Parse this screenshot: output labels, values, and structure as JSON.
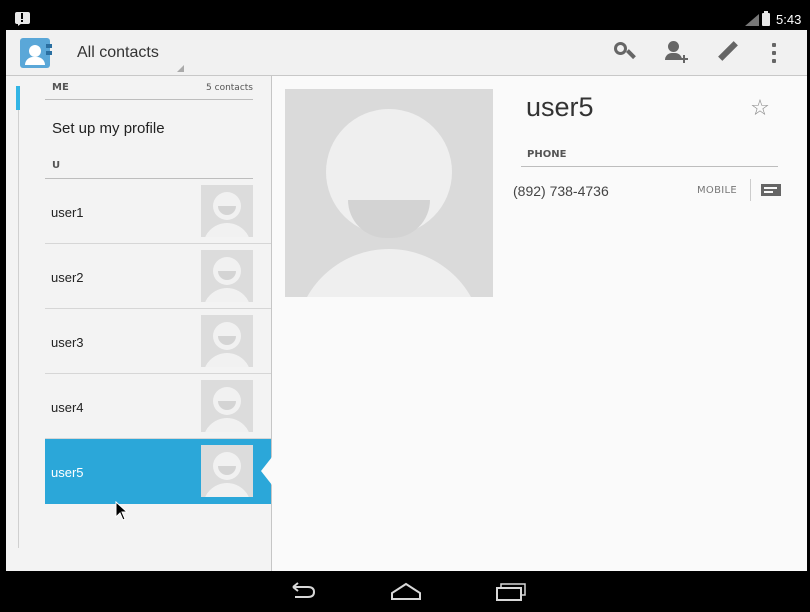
{
  "status_bar": {
    "time": "5:43",
    "notification_icon": "notification-alert-icon",
    "signal_icon": "signal-icon",
    "battery_icon": "battery-icon"
  },
  "action_bar": {
    "app_icon": "contacts-app-icon",
    "filter_label": "All contacts",
    "actions": [
      "search-icon",
      "add-contact-icon",
      "edit-icon",
      "overflow-menu-icon"
    ]
  },
  "list": {
    "me_section": {
      "title": "ME",
      "count_label": "5 contacts"
    },
    "setup_profile_label": "Set up my profile",
    "group_header": "U",
    "contacts": [
      {
        "name": "user1",
        "selected": false
      },
      {
        "name": "user2",
        "selected": false
      },
      {
        "name": "user3",
        "selected": false
      },
      {
        "name": "user4",
        "selected": false
      },
      {
        "name": "user5",
        "selected": true
      }
    ]
  },
  "detail": {
    "name": "user5",
    "favorite_icon": "star-outline-icon",
    "phone_section_title": "PHONE",
    "phone": {
      "number": "(892) 738-4736",
      "type": "MOBILE",
      "action_icon": "sms-icon"
    }
  },
  "nav_bar": {
    "buttons": [
      "back-icon",
      "home-icon",
      "recents-icon"
    ]
  },
  "colors": {
    "accent": "#33b5e5",
    "selected_row": "#2ba7d9",
    "placeholder_photo": "#dadada"
  }
}
